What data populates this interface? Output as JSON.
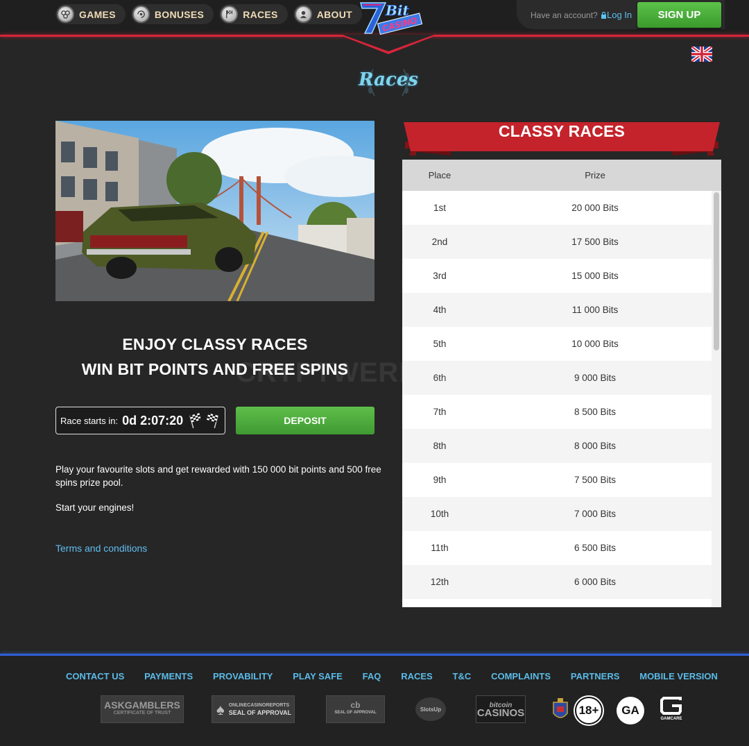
{
  "header": {
    "nav": [
      {
        "label": "GAMES",
        "icon": "games-icon"
      },
      {
        "label": "BONUSES",
        "icon": "bonuses-icon"
      },
      {
        "label": "RACES",
        "icon": "races-icon"
      },
      {
        "label": "ABOUT",
        "icon": "about-icon"
      }
    ],
    "logo_text": "7BitCasino",
    "account_prompt": "Have an account?",
    "login_label": "Log In",
    "signup_label": "SIGN UP",
    "language": "en-gb-flag"
  },
  "page_title": "Races",
  "promo": {
    "headline_line1": "ENJOY CLASSY RACES",
    "headline_line2": "WIN BIT POINTS AND FREE SPINS",
    "timer_label": "Race starts in:",
    "timer_value": "0d 2:07:20",
    "deposit_label": "DEPOSIT",
    "description": "Play your favourite slots and get rewarded with 150 000 bit points and 500 free spins prize pool.",
    "engines": "Start your engines!",
    "terms_label": "Terms and conditions"
  },
  "prize_table": {
    "banner_title": "CLASSY RACES",
    "headers": {
      "place": "Place",
      "prize": "Prize"
    },
    "rows": [
      {
        "place": "1st",
        "prize": "20 000 Bits"
      },
      {
        "place": "2nd",
        "prize": "17 500 Bits"
      },
      {
        "place": "3rd",
        "prize": "15 000 Bits"
      },
      {
        "place": "4th",
        "prize": "11 000 Bits"
      },
      {
        "place": "5th",
        "prize": "10 000 Bits"
      },
      {
        "place": "6th",
        "prize": "9 000 Bits"
      },
      {
        "place": "7th",
        "prize": "8 500 Bits"
      },
      {
        "place": "8th",
        "prize": "8 000 Bits"
      },
      {
        "place": "9th",
        "prize": "7 500 Bits"
      },
      {
        "place": "10th",
        "prize": "7 000 Bits"
      },
      {
        "place": "11th",
        "prize": "6 500 Bits"
      },
      {
        "place": "12th",
        "prize": "6 000 Bits"
      }
    ]
  },
  "watermark": "CRYPTWERK.COM",
  "footer": {
    "links": [
      "CONTACT US",
      "PAYMENTS",
      "PROVABILITY",
      "PLAY SAFE",
      "FAQ",
      "RACES",
      "T&C",
      "COMPLAINTS",
      "PARTNERS",
      "MOBILE VERSION"
    ],
    "badges": {
      "askgamblers": "ASKGAMBLERS",
      "askgamblers_sub": "CERTIFICATE OF TRUST",
      "ocr": "ONLINECASINOREPORTS",
      "ocr_sub": "SEAL OF APPROVAL",
      "cb": "SEAL OF APPROVAL",
      "slotsup": "SlotsUp",
      "bitcoin_casinos": "CASINOS",
      "bitcoin_label": "bitcoin",
      "age": "18+",
      "ga": "GA",
      "gamcare": "GAMCARE"
    }
  },
  "colors": {
    "accent_red": "#d6253a",
    "accent_blue": "#2f5fd8",
    "link_blue": "#5bbbe8",
    "green_button": "#4aae3a"
  }
}
